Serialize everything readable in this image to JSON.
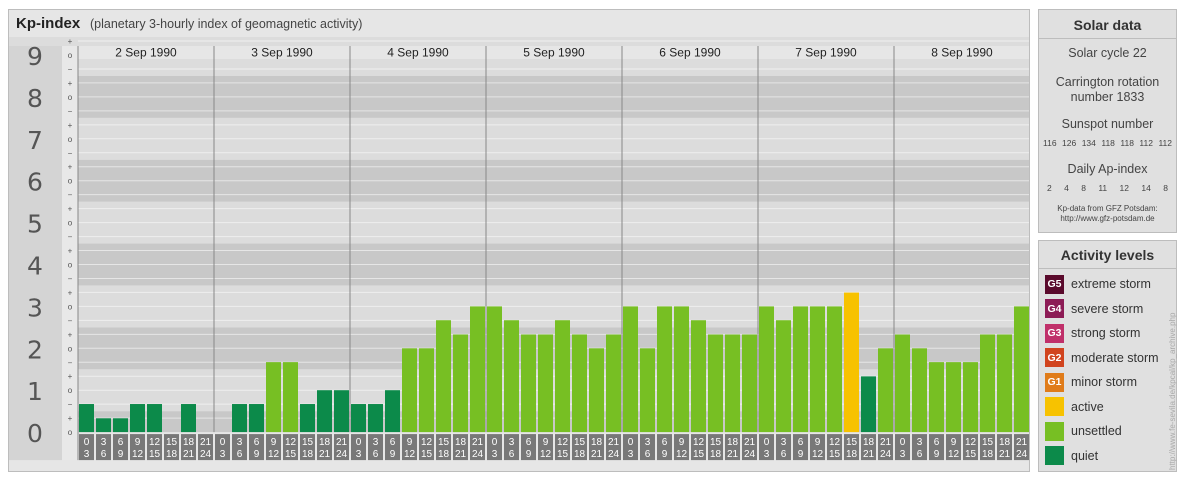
{
  "header": {
    "title": "Kp-index",
    "subtitle": "(planetary 3-hourly index of geomagnetic activity)"
  },
  "chart_data": {
    "type": "bar",
    "days": [
      "2 Sep 1990",
      "3 Sep 1990",
      "4 Sep 1990",
      "5 Sep 1990",
      "6 Sep 1990",
      "7 Sep 1990",
      "8 Sep 1990"
    ],
    "time_labels_top": [
      "0",
      "3",
      "6",
      "9",
      "12",
      "15",
      "18",
      "21"
    ],
    "time_labels_bottom": [
      "3",
      "6",
      "9",
      "12",
      "15",
      "18",
      "21",
      "24"
    ],
    "y_ticks": [
      "0",
      "1",
      "2",
      "3",
      "4",
      "5",
      "6",
      "7",
      "8",
      "9"
    ],
    "ylim": [
      0,
      9.33
    ],
    "sub_ticks": [
      "−",
      "o",
      "+"
    ],
    "values": [
      0.67,
      0.33,
      0.33,
      0.67,
      0.67,
      0,
      0.67,
      0,
      0,
      0.67,
      0.67,
      1.67,
      1.67,
      0.67,
      1,
      1,
      0.67,
      0.67,
      1,
      2,
      2,
      2.67,
      2.33,
      3,
      3,
      2.67,
      2.33,
      2.33,
      2.67,
      2.33,
      2,
      2.33,
      3,
      2,
      3,
      3,
      2.67,
      2.33,
      2.33,
      2.33,
      3,
      2.67,
      3,
      3,
      3,
      3.33,
      1.33,
      2,
      2.33,
      2,
      1.67,
      1.67,
      1.67,
      2.33,
      2.33,
      3
    ]
  },
  "colors": {
    "quiet": "#0c8a4a",
    "unsettled": "#77bf23",
    "active": "#f7c200",
    "g1": "#e07c1a",
    "g2": "#d1441e",
    "g3": "#c0306a",
    "g4": "#8c1b55",
    "g5": "#5a0a2c",
    "band_dark": "#c8c8c8",
    "band_light": "#dcdcdc",
    "tick_box": "#787878"
  },
  "solar": {
    "title": "Solar data",
    "cycle": "Solar cycle 22",
    "carrington_1": "Carrington rotation",
    "carrington_2": "number 1833",
    "sunspot_title": "Sunspot number",
    "sunspots": [
      "116",
      "126",
      "134",
      "118",
      "118",
      "112",
      "112"
    ],
    "ap_title": "Daily Ap-index",
    "ap": [
      "2",
      "4",
      "8",
      "11",
      "12",
      "14",
      "8"
    ],
    "source_1": "Kp-data from GFZ Potsdam:",
    "source_2": "http://www.gfz-potsdam.de"
  },
  "activity": {
    "title": "Activity levels",
    "levels": [
      {
        "badge": "G5",
        "label": "extreme storm"
      },
      {
        "badge": "G4",
        "label": "severe storm"
      },
      {
        "badge": "G3",
        "label": "strong storm"
      },
      {
        "badge": "G2",
        "label": "moderate storm"
      },
      {
        "badge": "G1",
        "label": "minor storm"
      },
      {
        "badge": "",
        "label": "active"
      },
      {
        "badge": "",
        "label": "unsettled"
      },
      {
        "badge": "",
        "label": "quiet"
      }
    ]
  },
  "watermark": "http://www.fe-sevila.de/kpcal/kp_archive.php"
}
